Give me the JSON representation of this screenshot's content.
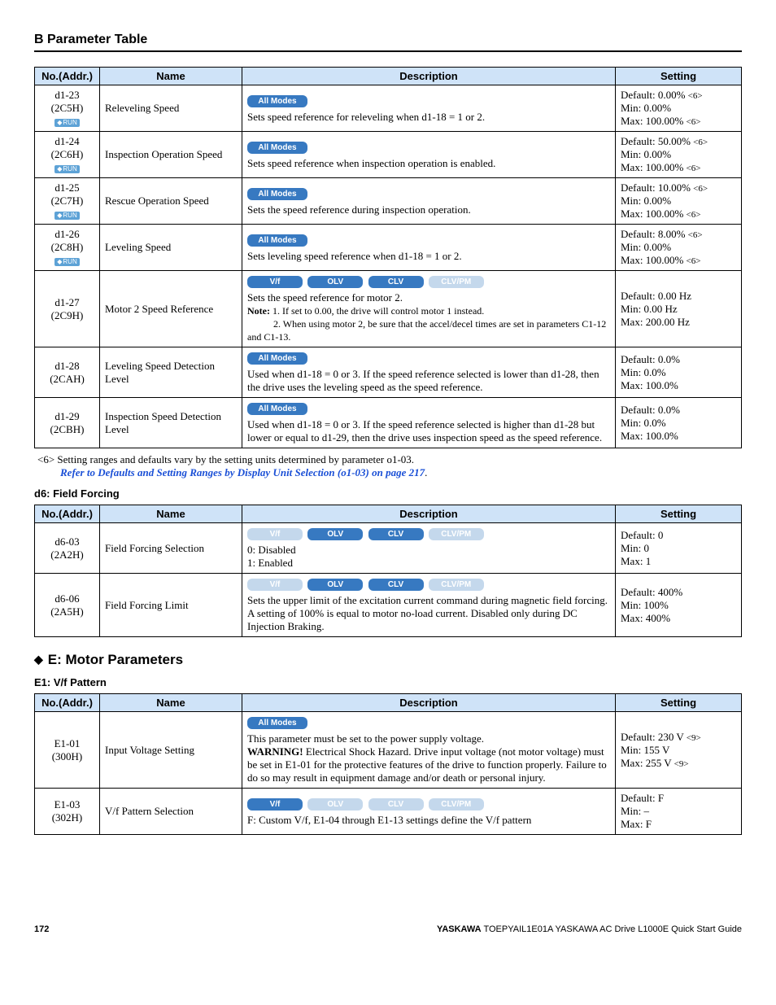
{
  "page_header": "B  Parameter Table",
  "table1": {
    "headers": {
      "no": "No.(Addr.)",
      "name": "Name",
      "desc": "Description",
      "set": "Setting"
    },
    "rows": [
      {
        "no_line1": "d1-23",
        "no_line2": "(2C5H)",
        "run": "RUN",
        "name": "Releveling Speed",
        "mode_all": "All Modes",
        "desc_text": "Sets speed reference for releveling when d1-18 = 1 or 2.",
        "s1": "Default: 0.00% ",
        "s1ref": "<6>",
        "s2": "Min: 0.00%",
        "s3": "Max: 100.00% ",
        "s3ref": "<6>"
      },
      {
        "no_line1": "d1-24",
        "no_line2": "(2C6H)",
        "run": "RUN",
        "name": "Inspection Operation Speed",
        "mode_all": "All Modes",
        "desc_text": "Sets speed reference when inspection operation is enabled.",
        "s1": "Default: 50.00% ",
        "s1ref": "<6>",
        "s2": "Min: 0.00%",
        "s3": "Max: 100.00% ",
        "s3ref": "<6>"
      },
      {
        "no_line1": "d1-25",
        "no_line2": "(2C7H)",
        "run": "RUN",
        "name": "Rescue Operation Speed",
        "mode_all": "All Modes",
        "desc_text": "Sets the speed reference during inspection operation.",
        "s1": "Default: 10.00% ",
        "s1ref": "<6>",
        "s2": "Min: 0.00%",
        "s3": "Max: 100.00% ",
        "s3ref": "<6>"
      },
      {
        "no_line1": "d1-26",
        "no_line2": "(2C8H)",
        "run": "RUN",
        "name": "Leveling Speed",
        "mode_all": "All Modes",
        "desc_text": "Sets leveling speed reference when d1-18 = 1 or 2.",
        "s1": "Default: 8.00% ",
        "s1ref": "<6>",
        "s2": "Min: 0.00%",
        "s3": "Max: 100.00% ",
        "s3ref": "<6>"
      },
      {
        "no_line1": "d1-27",
        "no_line2": "(2C9H)",
        "name": "Motor 2 Speed Reference",
        "m_vf": "V/f",
        "m_olv": "OLV",
        "m_clv": "CLV",
        "m_clvpm": "CLV/PM",
        "desc_text": "Sets the speed reference for motor 2.",
        "note_label": "Note: ",
        "note1": "1. If set to 0.00, the drive will control motor 1 instead.",
        "note2": "2. When using motor 2, be sure that the accel/decel times are set in parameters C1-12 and C1-13.",
        "s1": "Default: 0.00 Hz",
        "s2": "Min: 0.00 Hz",
        "s3": "Max: 200.00 Hz"
      },
      {
        "no_line1": "d1-28",
        "no_line2": "(2CAH)",
        "name": "Leveling Speed Detection Level",
        "mode_all": "All Modes",
        "desc_text": "Used when d1-18 = 0 or 3. If the speed reference selected is lower than d1-28, then the drive uses the leveling speed as the speed reference.",
        "s1": "Default: 0.0%",
        "s2": "Min: 0.0%",
        "s3": "Max: 100.0%"
      },
      {
        "no_line1": "d1-29",
        "no_line2": "(2CBH)",
        "name": "Inspection Speed Detection Level",
        "mode_all": "All Modes",
        "desc_text": "Used when d1-18 = 0 or 3. If the speed reference selected is higher than d1-28 but lower or equal to d1-29, then the drive uses inspection speed as the speed reference.",
        "s1": "Default: 0.0%",
        "s2": "Min: 0.0%",
        "s3": "Max: 100.0%"
      }
    ]
  },
  "footnote6_a": "<6> Setting ranges and defaults vary by the setting units determined by parameter o1-03.",
  "footnote6_b": "Refer to Defaults and Setting Ranges by Display Unit Selection (o1-03) on page 217",
  "footnote6_c": ".",
  "sub_d6": "d6: Field Forcing",
  "table2": {
    "headers": {
      "no": "No.(Addr.)",
      "name": "Name",
      "desc": "Description",
      "set": "Setting"
    },
    "rows": [
      {
        "no_line1": "d6-03",
        "no_line2": "(2A2H)",
        "name": "Field Forcing Selection",
        "m_vf": "V/f",
        "m_olv": "OLV",
        "m_clv": "CLV",
        "m_clvpm": "CLV/PM",
        "desc_l1": "0: Disabled",
        "desc_l2": "1: Enabled",
        "s1": "Default: 0",
        "s2": "Min: 0",
        "s3": "Max: 1"
      },
      {
        "no_line1": "d6-06",
        "no_line2": "(2A5H)",
        "name": "Field Forcing Limit",
        "m_vf": "V/f",
        "m_olv": "OLV",
        "m_clv": "CLV",
        "m_clvpm": "CLV/PM",
        "desc_text": "Sets the upper limit of the excitation current command during magnetic field forcing. A setting of 100% is equal to motor no-load current. Disabled only during DC Injection Braking.",
        "s1": "Default: 400%",
        "s2": "Min: 100%",
        "s3": "Max: 400%"
      }
    ]
  },
  "section_e": "E: Motor Parameters",
  "sub_e1": "E1: V/f Pattern",
  "table3": {
    "headers": {
      "no": "No.(Addr.)",
      "name": "Name",
      "desc": "Description",
      "set": "Setting"
    },
    "rows": [
      {
        "no_line1": "E1-01",
        "no_line2": "(300H)",
        "name": "Input Voltage Setting",
        "mode_all": "All Modes",
        "desc_l1": "This parameter must be set to the power supply voltage.",
        "warn_label": "WARNING!",
        "desc_l2": " Electrical Shock Hazard. Drive input voltage (not motor voltage) must be set in E1-01 for the protective features of the drive to function properly. Failure to do so may result in equipment damage and/or death or personal injury.",
        "s1": "Default: 230 V ",
        "s1ref": "<9>",
        "s2": "Min: 155 V",
        "s3": "Max: 255 V ",
        "s3ref": "<9>"
      },
      {
        "no_line1": "E1-03",
        "no_line2": "(302H)",
        "name": "V/f Pattern Selection",
        "m_vf": "V/f",
        "m_olv": "OLV",
        "m_clv": "CLV",
        "m_clvpm": "CLV/PM",
        "desc_text": "F: Custom V/f, E1-04 through E1-13 settings define the V/f pattern",
        "s1": "Default: F",
        "s2": "Min: –",
        "s3": "Max: F"
      }
    ]
  },
  "footer": {
    "page": "172",
    "right_bold": "YASKAWA",
    "right_rest": " TOEPYAIL1E01A YASKAWA AC Drive L1000E Quick Start Guide"
  }
}
